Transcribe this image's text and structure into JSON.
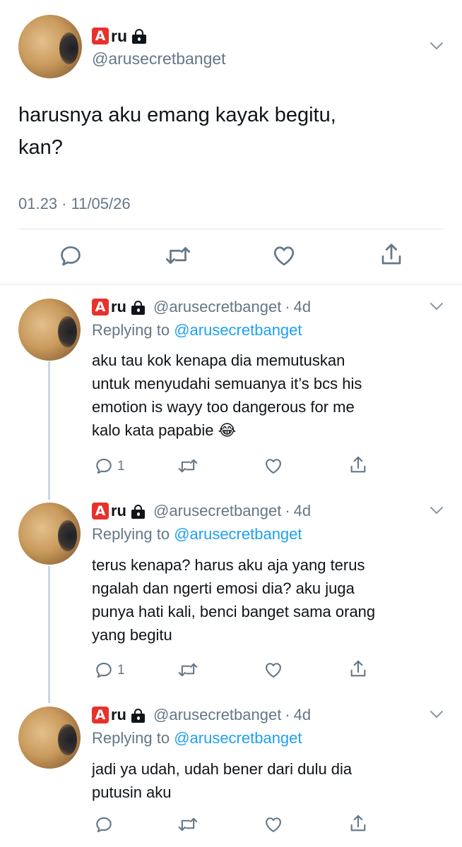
{
  "main": {
    "badge": "A",
    "name": "ru",
    "handle": "@arusecretbanget",
    "text_line1": "harusnya aku emang kayak begitu,",
    "text_line2": "kan?",
    "timestamp": "01.23 · 11/05/26",
    "icons": [
      "reply-icon",
      "retweet-icon",
      "like-icon",
      "share-icon"
    ]
  },
  "replies": [
    {
      "badge": "A",
      "name": "ru",
      "handle": "@arusecretbanget",
      "dot": "·",
      "age": "4d",
      "replying_prefix": "Replying to ",
      "replying_to": "@arusecretbanget",
      "lines": [
        "aku tau kok kenapa dia memutuskan",
        "untuk menyudahi semuanya it’s bcs his",
        "emotion is wayy too dangerous for me",
        "kalo kata papabie"
      ],
      "emoji": "😂",
      "reply_count": "1"
    },
    {
      "badge": "A",
      "name": "ru",
      "handle": "@arusecretbanget",
      "dot": "·",
      "age": "4d",
      "replying_prefix": "Replying to ",
      "replying_to": "@arusecretbanget",
      "lines": [
        "terus kenapa? harus aku aja yang terus",
        "ngalah dan ngerti emosi dia? aku juga",
        "punya hati kali, benci banget sama orang",
        "yang begitu"
      ],
      "reply_count": "1"
    },
    {
      "badge": "A",
      "name": "ru",
      "handle": "@arusecretbanget",
      "dot": "·",
      "age": "4d",
      "replying_prefix": "Replying to ",
      "replying_to": "@arusecretbanget",
      "lines": [
        "jadi ya udah, udah bener dari dulu dia",
        "putusin aku"
      ],
      "reply_count": ""
    }
  ],
  "colors": {
    "badge_red": "#e8312b",
    "link_blue": "#1da1f2",
    "secondary_text": "#657786",
    "divider": "#e1e8ed"
  }
}
